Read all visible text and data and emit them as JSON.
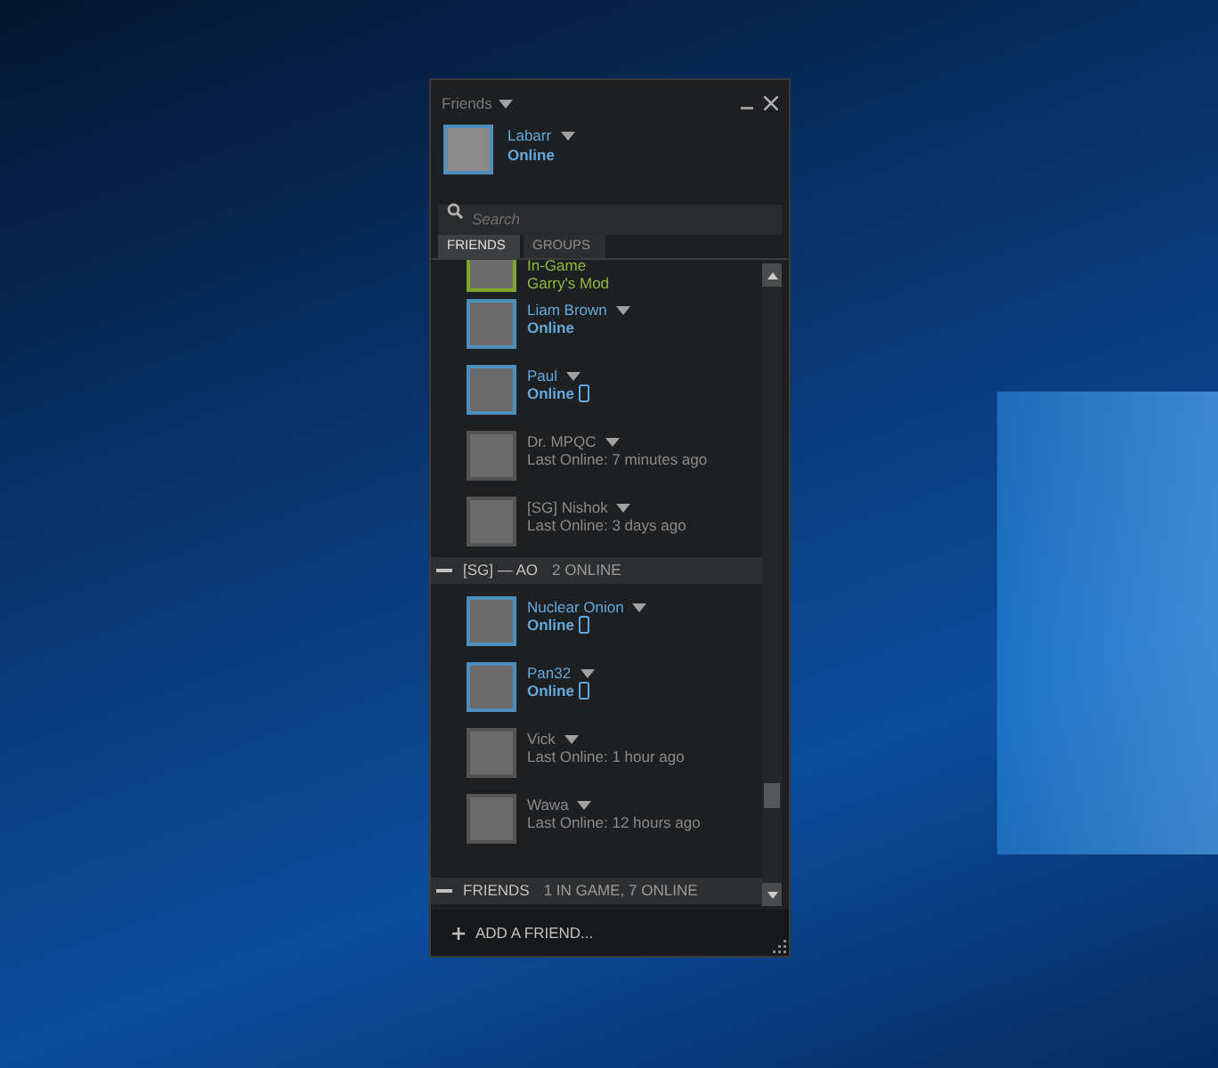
{
  "window": {
    "title": "Friends"
  },
  "user": {
    "name": "Labarr",
    "status": "Online"
  },
  "search": {
    "placeholder": "Search"
  },
  "tabs": [
    {
      "label": "FRIENDS",
      "selected": true
    },
    {
      "label": "GROUPS",
      "selected": false
    }
  ],
  "groups": [
    {
      "friends": [
        {
          "kind": "ingame",
          "status": "In-Game",
          "detail": "Garry's Mod",
          "mobile": false
        },
        {
          "kind": "online",
          "name": "Liam Brown",
          "status": "Online",
          "mobile": false
        },
        {
          "kind": "online",
          "name": "Paul",
          "status": "Online",
          "mobile": true
        },
        {
          "kind": "offline",
          "name": "Dr. MPQC",
          "status": "Last Online: 7 minutes ago",
          "mobile": false
        },
        {
          "kind": "offline",
          "name": "[SG] Nishok",
          "status": "Last Online: 3 days ago",
          "mobile": false
        }
      ]
    },
    {
      "name": "[SG] — AO",
      "count": "2 ONLINE",
      "expanded": true,
      "friends": [
        {
          "kind": "online",
          "name": "Nuclear Onion",
          "status": "Online",
          "mobile": true
        },
        {
          "kind": "online",
          "name": "Pan32",
          "status": "Online",
          "mobile": true
        },
        {
          "kind": "offline",
          "name": "Vick",
          "status": "Last Online: 1 hour ago",
          "mobile": false
        },
        {
          "kind": "offline",
          "name": "Wawa",
          "status": "Last Online: 12 hours ago",
          "mobile": false
        }
      ]
    }
  ],
  "pinned_group": {
    "name": "FRIENDS",
    "count": "1 IN GAME, 7 ONLINE",
    "expanded": true
  },
  "footer": {
    "label": "ADD A FRIEND..."
  }
}
